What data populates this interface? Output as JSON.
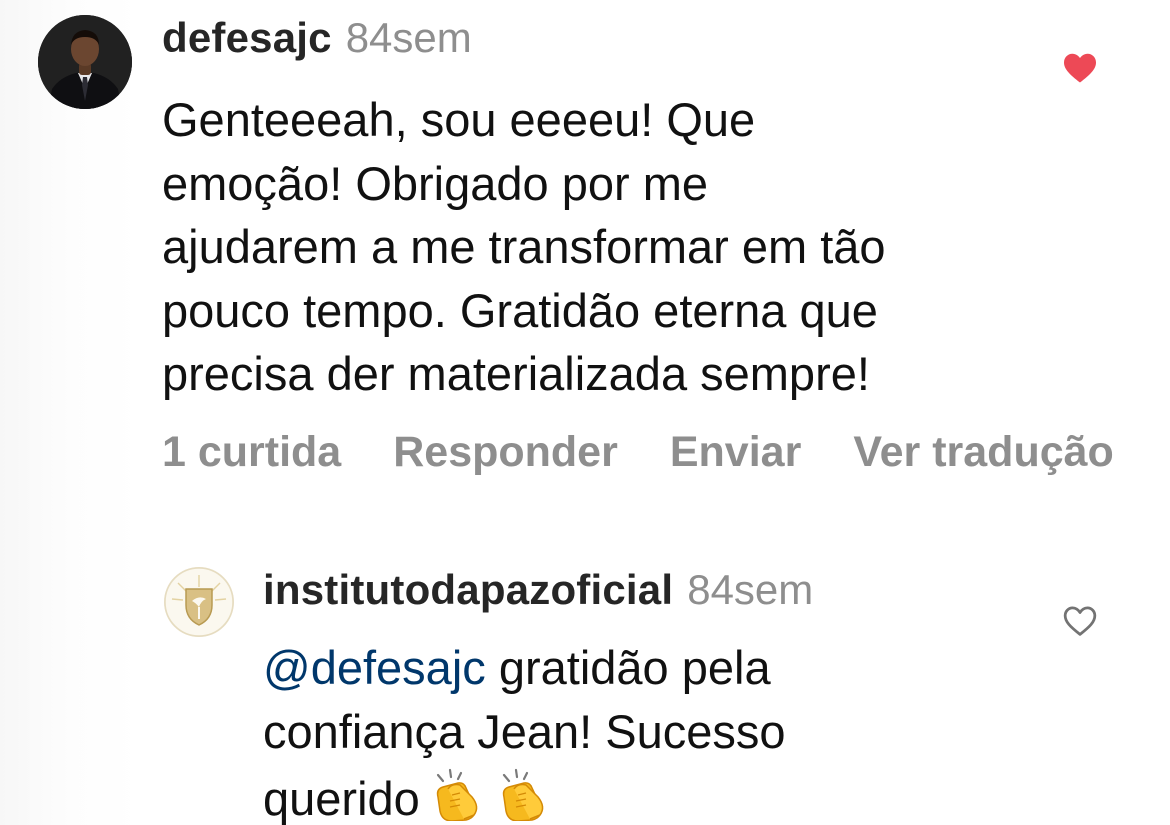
{
  "comments": [
    {
      "username": "defesajc",
      "timestamp": "84sem",
      "text": "Genteeeah, sou eeeeu! Que\nemoção! Obrigado por me\najudarem a me transformar em tão\npouco tempo. Gratidão eterna que\nprecisa der materializada sempre!",
      "liked": true,
      "actions": {
        "likes": "1 curtida",
        "reply": "Responder",
        "send": "Enviar",
        "translate": "Ver tradução"
      }
    },
    {
      "username": "institutodapazoficial",
      "timestamp": "84sem",
      "mention": "@defesajc",
      "text_line1": " gratidão pela",
      "text_line2": "confiança Jean! Sucesso",
      "text_line3": "querido",
      "emoji": "👏👏",
      "liked": false
    }
  ],
  "colors": {
    "like_active": "#ed4956",
    "muted": "#8e8e8e",
    "mention": "#00376b"
  },
  "icons": {
    "liked": "heart-filled-icon",
    "not_liked": "heart-outline-icon",
    "emoji": "clapping-hands-emoji"
  }
}
